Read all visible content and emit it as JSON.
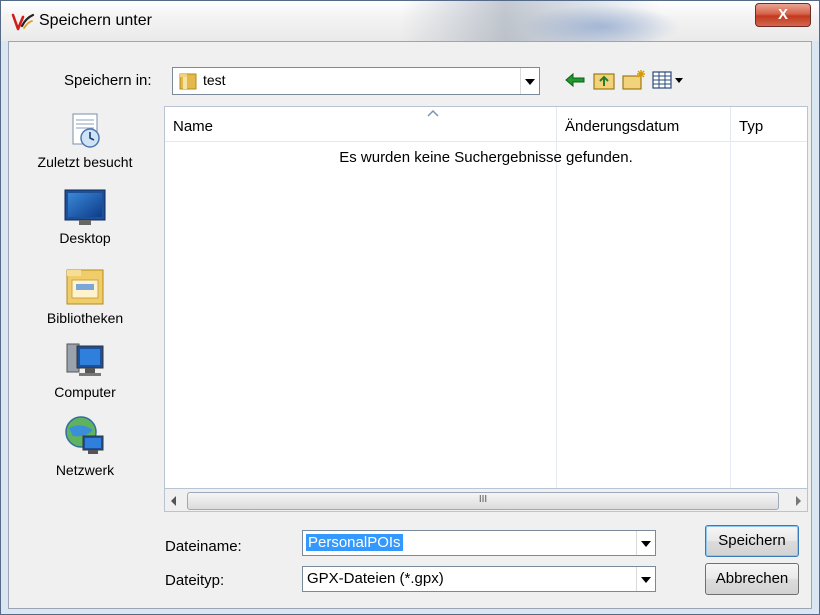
{
  "window": {
    "title": "Speichern unter",
    "close_label": "X"
  },
  "toolbar": {
    "save_in_label": "Speichern in:",
    "current_folder": "test",
    "icons": [
      "back-arrow-icon",
      "up-folder-icon",
      "new-folder-icon",
      "view-menu-icon"
    ]
  },
  "places": [
    {
      "label": "Zuletzt besucht",
      "icon": "recent-places-icon"
    },
    {
      "label": "Desktop",
      "icon": "desktop-icon"
    },
    {
      "label": "Bibliotheken",
      "icon": "libraries-icon"
    },
    {
      "label": "Computer",
      "icon": "computer-icon"
    },
    {
      "label": "Netzwerk",
      "icon": "network-icon"
    }
  ],
  "file_list": {
    "columns": [
      "Name",
      "Änderungsdatum",
      "Typ"
    ],
    "empty_message": "Es wurden keine Suchergebnisse gefunden.",
    "scroll_grip": "III"
  },
  "form": {
    "filename_label": "Dateiname:",
    "filename_value": "PersonalPOIs",
    "filetype_label": "Dateityp:",
    "filetype_value": "GPX-Dateien (*.gpx)"
  },
  "buttons": {
    "save": "Speichern",
    "cancel": "Abbrechen"
  },
  "colors": {
    "selection": "#3399ff",
    "close_button": "#c2391f"
  }
}
